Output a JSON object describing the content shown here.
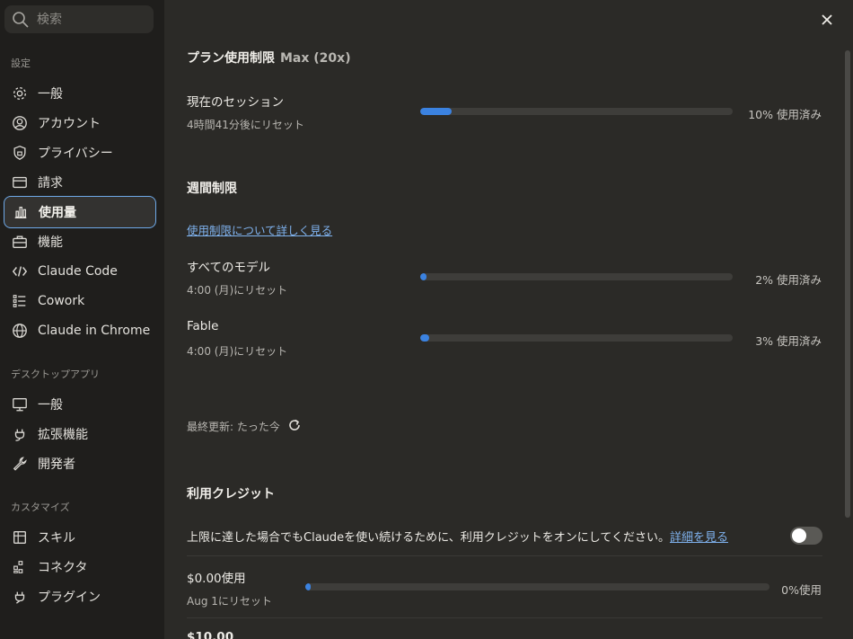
{
  "search": {
    "placeholder": "検索"
  },
  "sidebar": {
    "section_settings": "設定",
    "settings_items": [
      {
        "label": "一般",
        "icon": "gear-icon"
      },
      {
        "label": "アカウント",
        "icon": "user-circle-icon"
      },
      {
        "label": "プライバシー",
        "icon": "shield-lock-icon"
      },
      {
        "label": "請求",
        "icon": "credit-card-icon"
      },
      {
        "label": "使用量",
        "icon": "bar-chart-icon"
      },
      {
        "label": "機能",
        "icon": "toolbox-icon"
      },
      {
        "label": "Claude Code",
        "icon": "code-icon"
      },
      {
        "label": "Cowork",
        "icon": "checklist-icon"
      },
      {
        "label": "Claude in Chrome",
        "icon": "globe-icon"
      }
    ],
    "section_desktop": "デスクトップアプリ",
    "desktop_items": [
      {
        "label": "一般",
        "icon": "monitor-icon"
      },
      {
        "label": "拡張機能",
        "icon": "plug-icon"
      },
      {
        "label": "開発者",
        "icon": "wrench-icon"
      }
    ],
    "section_customize": "カスタマイズ",
    "customize_items": [
      {
        "label": "スキル",
        "icon": "skill-icon"
      },
      {
        "label": "コネクタ",
        "icon": "connector-icon"
      },
      {
        "label": "プラグイン",
        "icon": "plugin-icon"
      }
    ],
    "active_item": "使用量"
  },
  "usage": {
    "plan_title": "プラン使用制限",
    "plan_tier": "Max (20x)",
    "session": {
      "title": "現在のセッション",
      "reset": "4時間41分後にリセット",
      "percent_text": "10% 使用済み",
      "progress": 0.1
    },
    "weekly_title": "週間制限",
    "learn_more": "使用制限について詳しく見る",
    "all_models": {
      "title": "すべてのモデル",
      "reset": "4:00 (月)にリセット",
      "percent_text": "2% 使用済み",
      "progress": 0.02
    },
    "fable": {
      "title": "Fable",
      "reset": "4:00 (月)にリセット",
      "percent_text": "3% 使用済み",
      "progress": 0.03
    },
    "last_updated": "最終更新: たった今"
  },
  "credits": {
    "title": "利用クレジット",
    "description": "上限に達した場合でもClaudeを使い続けるために、利用クレジットをオンにしてください。",
    "details_link": "詳細を見る",
    "toggle_on": false,
    "used": {
      "title": "$0.00使用",
      "reset": "Aug 1にリセット",
      "percent_text": "0%使用",
      "progress": 0.0
    },
    "limit": {
      "title": "$10.00"
    }
  },
  "colors": {
    "accent": "#3b82e0",
    "link": "#7fb2ee",
    "active_border": "#6ea9e8"
  }
}
